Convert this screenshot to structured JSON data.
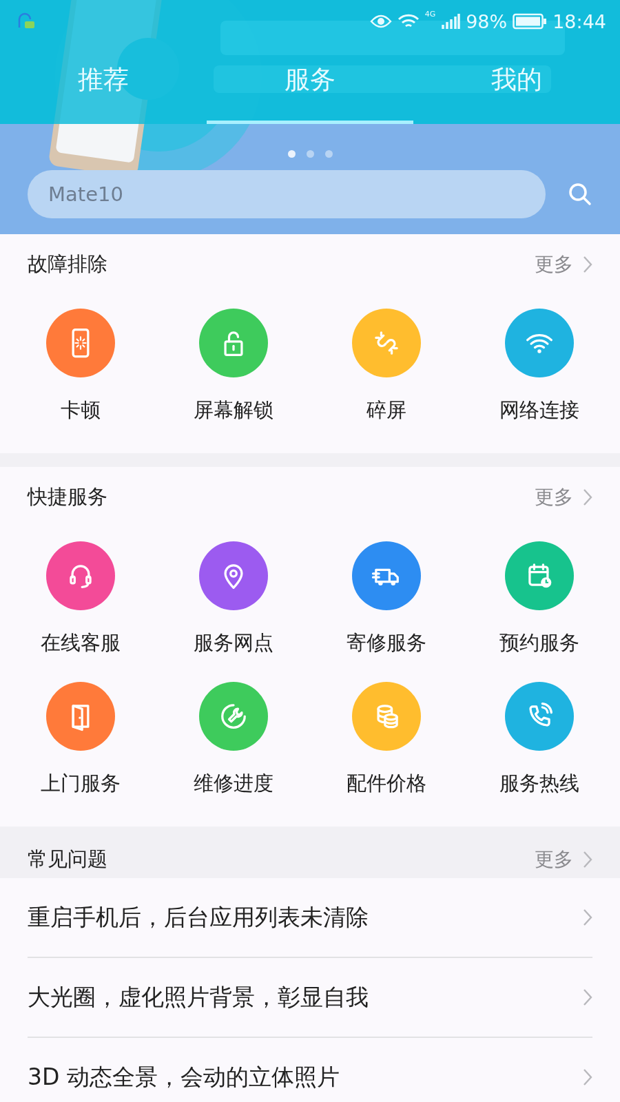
{
  "status_bar": {
    "battery": "98%",
    "time": "18:44",
    "network": "4G"
  },
  "tabs": [
    {
      "label": "推荐",
      "selected": false
    },
    {
      "label": "服务",
      "selected": true
    },
    {
      "label": "我的",
      "selected": false
    }
  ],
  "pager": [
    {
      "selected": true
    },
    {
      "selected": false
    },
    {
      "selected": false
    }
  ],
  "search": {
    "placeholder": "Mate10"
  },
  "sections": [
    {
      "title": "故障排除",
      "more": "更多",
      "items": [
        {
          "label": "卡顿",
          "color": "#ff7a3a"
        },
        {
          "label": "屏幕解锁",
          "color": "#3ecb5c"
        },
        {
          "label": "碎屏",
          "color": "#ffbd2e"
        },
        {
          "label": "网络连接",
          "color": "#1fb3e0"
        }
      ]
    },
    {
      "title": "快捷服务",
      "more": "更多",
      "items": [
        {
          "label": "在线客服",
          "color": "#f34b98"
        },
        {
          "label": "服务网点",
          "color": "#9c5bf0"
        },
        {
          "label": "寄修服务",
          "color": "#2d8df2"
        },
        {
          "label": "预约服务",
          "color": "#17c38d"
        },
        {
          "label": "上门服务",
          "color": "#ff7a3a"
        },
        {
          "label": "维修进度",
          "color": "#3ecb5c"
        },
        {
          "label": "配件价格",
          "color": "#ffbd2e"
        },
        {
          "label": "服务热线",
          "color": "#1fb3e0"
        }
      ]
    }
  ],
  "faq": {
    "title": "常见问题",
    "more": "更多",
    "items": [
      "重启手机后，后台应用列表未清除",
      "大光圈，虚化照片背景，彰显自我",
      "3D 动态全景，会动的立体照片"
    ]
  }
}
